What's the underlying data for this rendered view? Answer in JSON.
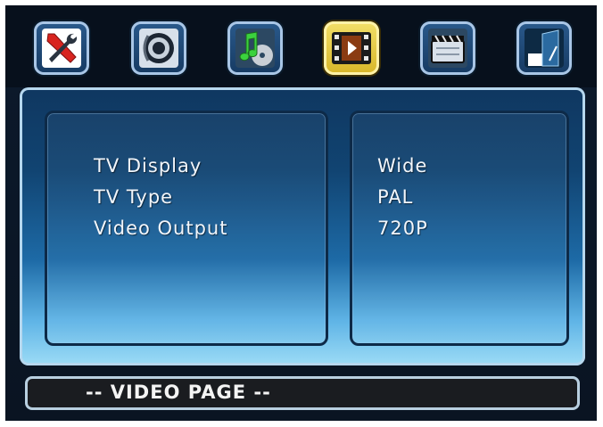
{
  "toolbar": {
    "tabs": [
      {
        "name": "general-setup",
        "icon": "tools-icon",
        "active": false
      },
      {
        "name": "audio-setup",
        "icon": "speaker-icon",
        "active": false
      },
      {
        "name": "music-setup",
        "icon": "music-disc-icon",
        "active": false
      },
      {
        "name": "video-setup",
        "icon": "film-icon",
        "active": true
      },
      {
        "name": "preference",
        "icon": "clapperboard-icon",
        "active": false
      },
      {
        "name": "exit",
        "icon": "exit-door-icon",
        "active": false
      }
    ]
  },
  "video_page": {
    "settings": [
      {
        "label": "TV Display",
        "value": "Wide"
      },
      {
        "label": "TV Type",
        "value": "PAL"
      },
      {
        "label": "Video Output",
        "value": "720P"
      }
    ]
  },
  "status": {
    "text": "-- VIDEO PAGE --"
  },
  "colors": {
    "accent_active": "#f3e06a",
    "panel_top": "#0f3760",
    "panel_bottom": "#9ddcf6",
    "status_bar": "#1a1c20"
  }
}
